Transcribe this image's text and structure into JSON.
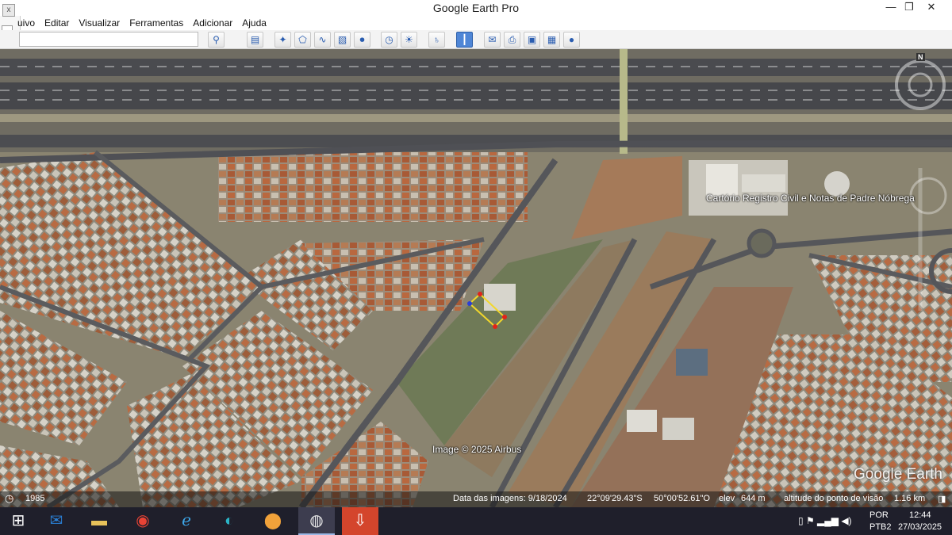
{
  "window": {
    "title": "Google Earth Pro",
    "minimize": "—",
    "restore": "❐",
    "close": "✕",
    "side_close": "x"
  },
  "menu": [
    "uivo",
    "Editar",
    "Visualizar",
    "Ferramentas",
    "Adicionar",
    "Ajuda"
  ],
  "search": {
    "value": "",
    "placeholder": ""
  },
  "toolbar_icons": [
    "search-icon",
    "sidebar-toggle-icon",
    "placemark-icon",
    "polygon-icon",
    "path-icon",
    "overlay-icon",
    "tour-icon",
    "historical-imagery-icon",
    "sunlight-icon",
    "planets-icon",
    "ruler-icon",
    "email-icon",
    "print-icon",
    "save-image-icon",
    "maps-icon",
    "globe-icon"
  ],
  "map": {
    "place_label": "Cartório Registro Civil e Notas de Padre Nóbrega",
    "image_credit": "Image © 2025 Airbus",
    "brand": "Google Earth",
    "north": "N"
  },
  "status": {
    "year": "1985",
    "imagery_date": "Data das imagens: 9/18/2024",
    "lat": "22°09'29.43\"S",
    "lon": "50°00'52.61\"O",
    "elev": "elev",
    "elev_value": "644 m",
    "eye_alt": "altitude do ponto de visão",
    "eye_alt_value": "1.16 km"
  },
  "taskbar": {
    "apps": [
      "windows-start-icon",
      "outlook-icon",
      "file-explorer-icon",
      "chrome-icon",
      "internet-explorer-icon",
      "edge-icon",
      "vpn-icon",
      "google-earth-icon",
      "acrobat-icon"
    ],
    "lang": "POR",
    "layout": "PTB2",
    "time": "12:44",
    "date": "27/03/2025"
  }
}
